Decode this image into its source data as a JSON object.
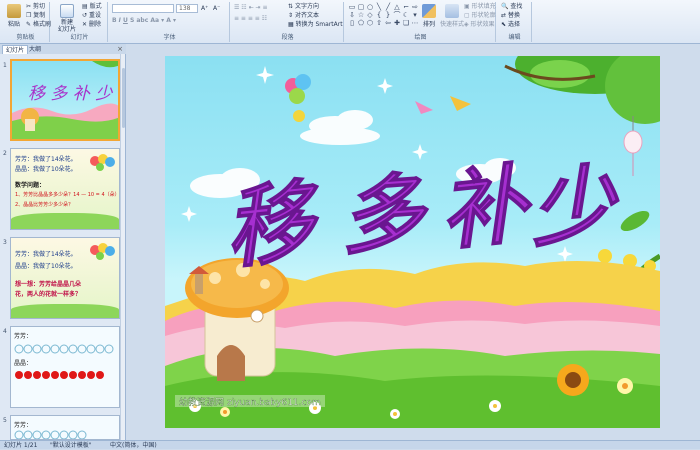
{
  "ribbon": {
    "clipboard": {
      "label": "剪贴板",
      "paste": "粘贴",
      "cut": "剪切",
      "copy": "复制",
      "format_painter": "格式刷"
    },
    "slides": {
      "label": "幻灯片",
      "new_slide": "新建\n幻灯片",
      "layout": "版式",
      "reset": "重设",
      "delete": "删除"
    },
    "font": {
      "label": "字体",
      "font_size": "138"
    },
    "paragraph": {
      "label": "段落",
      "text_direction": "文字方向",
      "align_text": "对齐文本",
      "smartart": "转换为 SmartArt"
    },
    "drawing": {
      "label": "绘图",
      "arrange": "排列",
      "quick_styles": "快速样式",
      "shape_fill": "形状填充",
      "shape_outline": "形状轮廓",
      "shape_effects": "形状效果"
    },
    "editing": {
      "label": "编辑",
      "find": "查找",
      "replace": "替换",
      "select": "选择"
    }
  },
  "pane": {
    "tab_slides": "幻灯片",
    "tab_outline": "大纲"
  },
  "thumbs": {
    "t1": {
      "num": "1"
    },
    "t2": {
      "num": "2",
      "l1": "芳芳：我做了14朵花。",
      "l2": "晶晶：我做了10朵花。",
      "l3": "数学问题：",
      "l4": "1、芳芳比晶晶多多少朵？14 — 10 = 4（朵）",
      "l5": "2、晶晶比芳芳少多少朵？"
    },
    "t3": {
      "num": "3",
      "l1": "芳芳：我做了14朵花。",
      "l2": "晶晶：我做了10朵花。",
      "l3": "想一想：芳芳给晶晶几朵",
      "l4": "花，两人的花就一样多？"
    },
    "t4": {
      "num": "4",
      "l1": "芳芳：",
      "l2": "晶晶："
    },
    "t5": {
      "num": "5",
      "l1": "芳芳："
    }
  },
  "slide": {
    "title_chars": [
      "移",
      "多",
      "补",
      "少"
    ],
    "watermark": "幼教资源网 ziyuan.baby611.com"
  },
  "status": {
    "slide_of": "幻灯片 1/21",
    "theme": "\"默认设计模板\"",
    "lang": "中文(简体，中国)"
  }
}
